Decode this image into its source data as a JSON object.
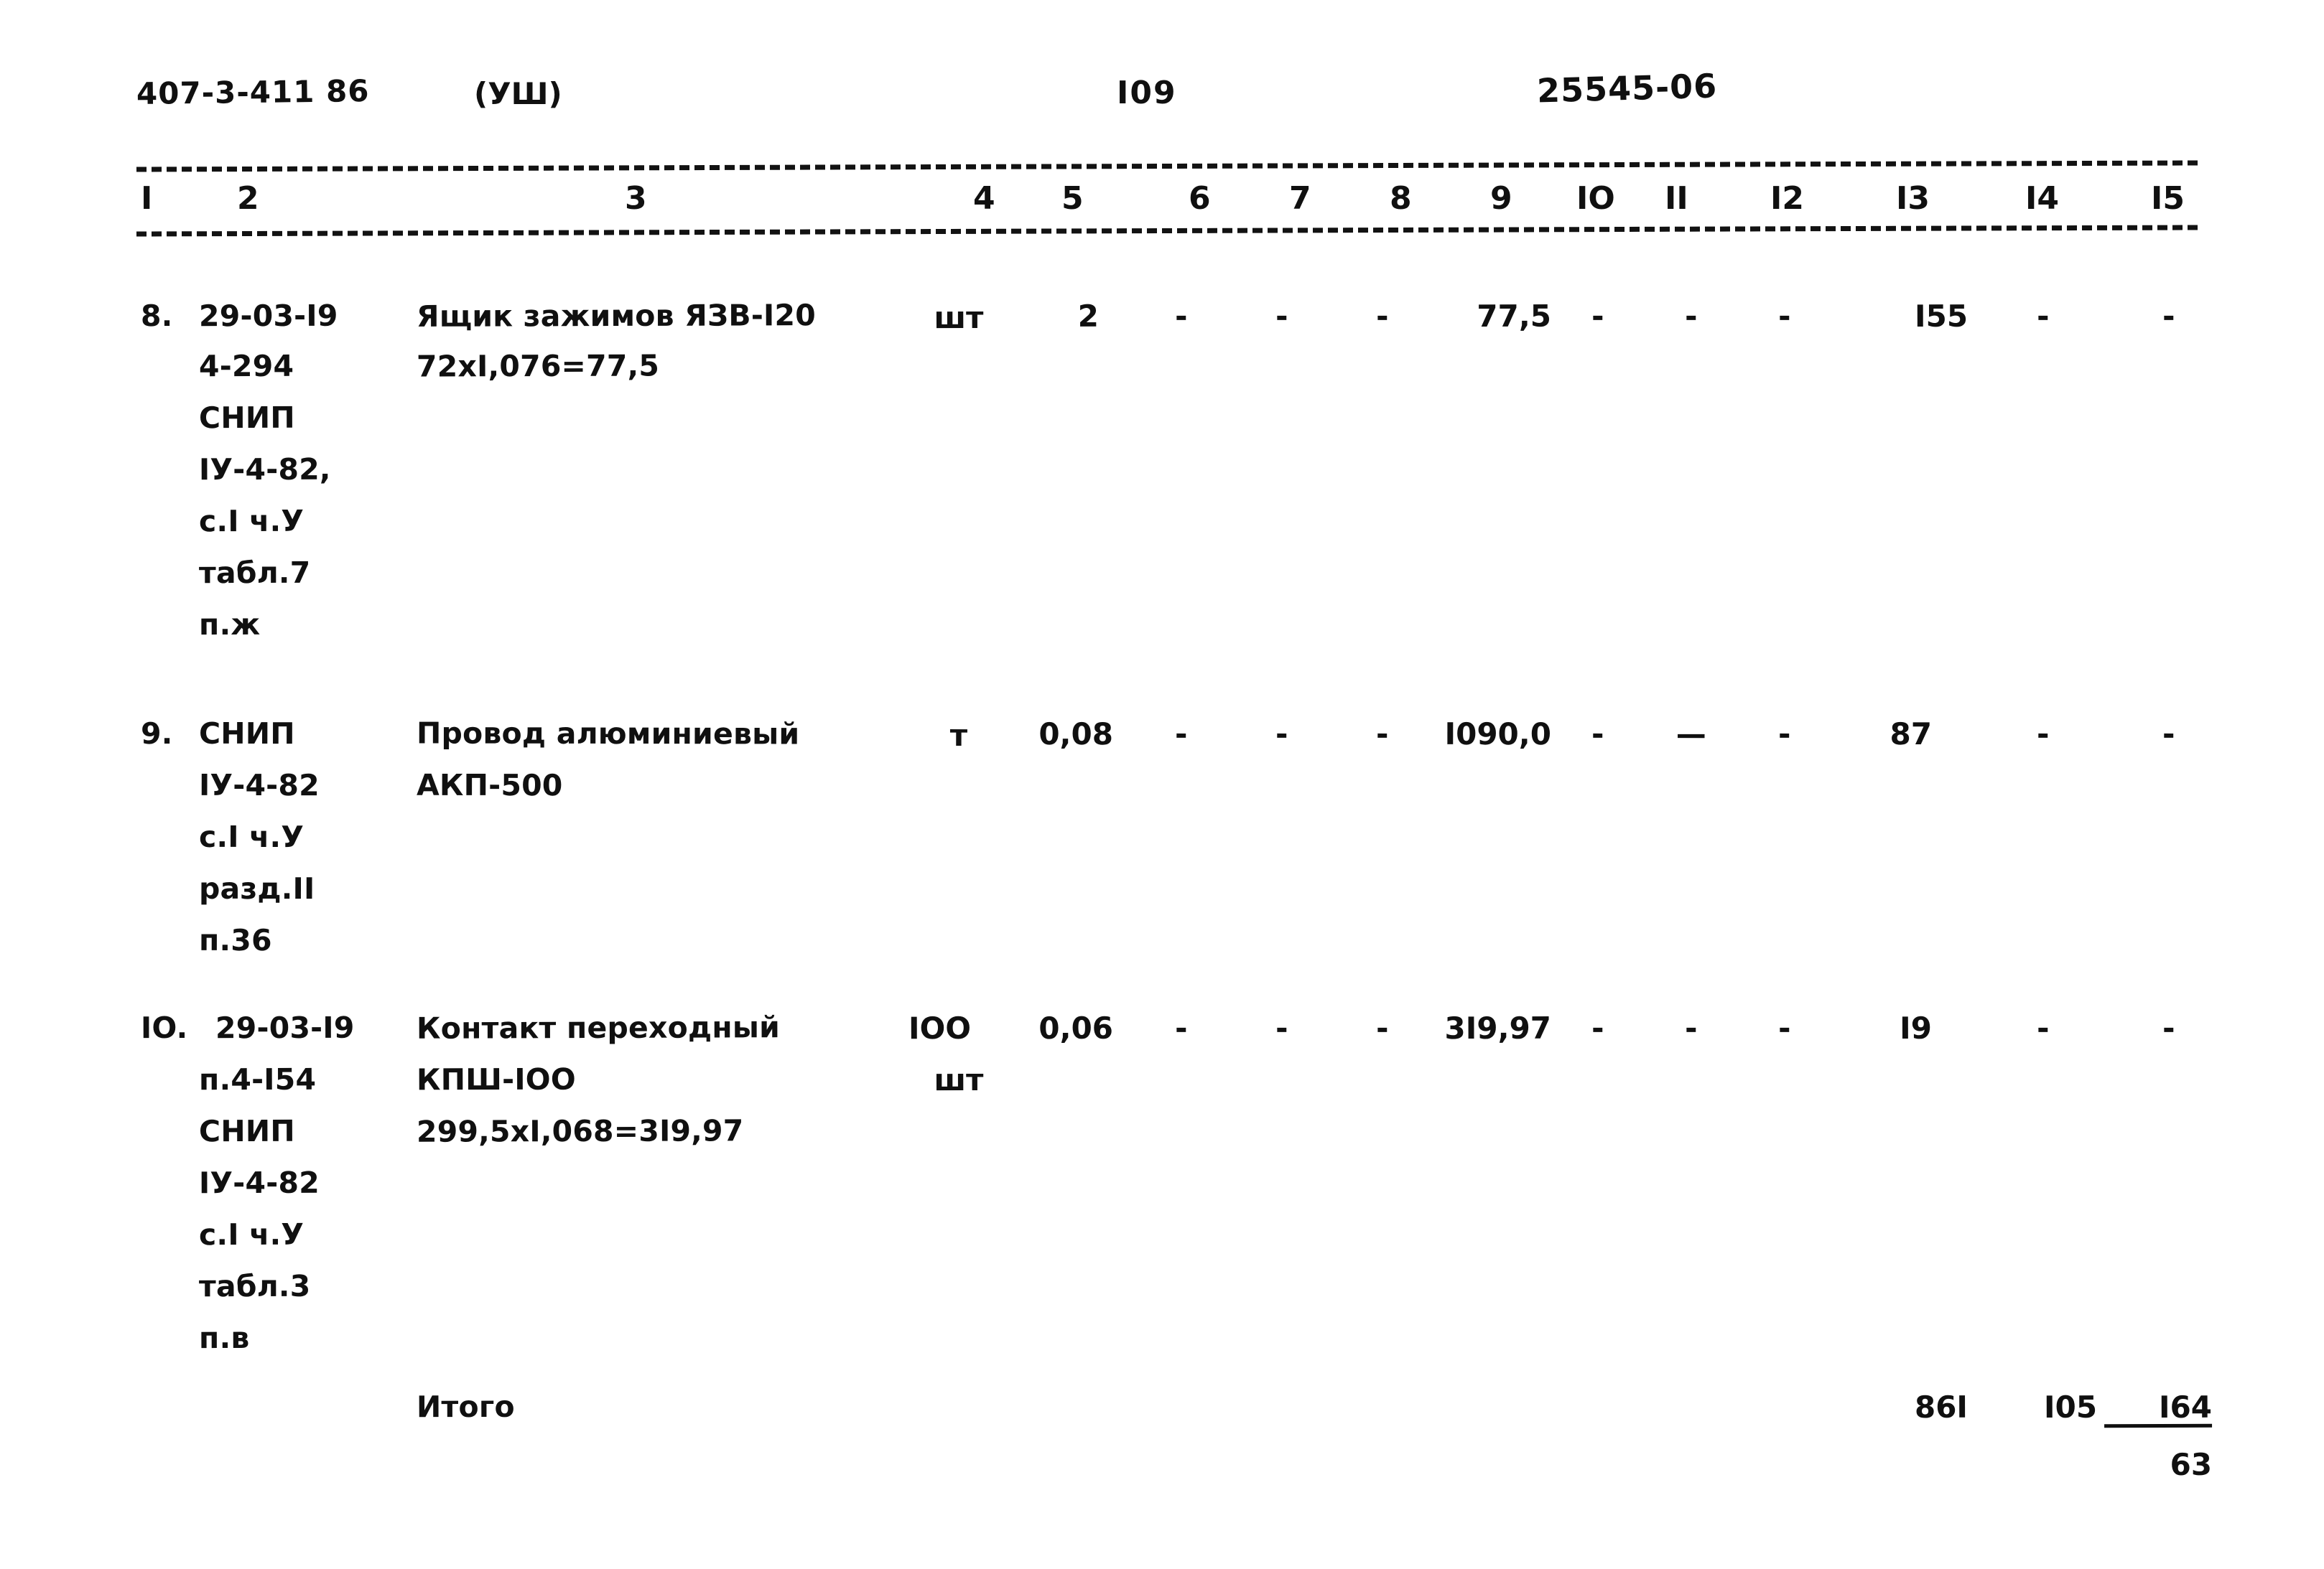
{
  "header": {
    "series_code": "407-3-411 86",
    "part_label": "(УШ)",
    "page_number": "I09",
    "doc_number": "25545-06"
  },
  "table": {
    "column_numbers": [
      "I",
      "2",
      "3",
      "4",
      "5",
      "6",
      "7",
      "8",
      "9",
      "IO",
      "II",
      "I2",
      "I3",
      "I4",
      "I5"
    ],
    "rows": [
      {
        "index": "8.",
        "code_lines": [
          "29-03-I9",
          "4-294",
          "СНИП",
          "IУ-4-82,",
          "с.I ч.У",
          "табл.7",
          "п.ж"
        ],
        "description_lines": [
          "Ящик зажимов ЯЗВ-I20",
          "72хI,076=77,5"
        ],
        "unit_lines": [
          "шт"
        ],
        "qty": "2",
        "c6": "-",
        "c7": "-",
        "c8": "-",
        "c9": "77,5",
        "c10": "-",
        "c11": "-",
        "c12": "-",
        "c13": "I55",
        "c14": "-",
        "c15": "-"
      },
      {
        "index": "9.",
        "code_lines": [
          "СНИП",
          "IУ-4-82",
          "с.I ч.У",
          "разд.II",
          "п.36"
        ],
        "description_lines": [
          "Провод алюминиевый",
          "АКП-500"
        ],
        "unit_lines": [
          "т"
        ],
        "qty": "0,08",
        "c6": "-",
        "c7": "-",
        "c8": "-",
        "c9": "I090,0",
        "c10": "-",
        "c11": "—",
        "c12": "-",
        "c13": "87",
        "c14": "-",
        "c15": "-"
      },
      {
        "index": "IO.",
        "code_lines": [
          "29-03-I9",
          "п.4-I54",
          "СНИП",
          "IУ-4-82",
          "с.I ч.У",
          "табл.3",
          "п.в"
        ],
        "description_lines": [
          "Контакт переходный",
          "КПШ-IOO",
          "299,5хI,068=3I9,97"
        ],
        "unit_lines": [
          "IOO",
          "шт"
        ],
        "qty": "0,06",
        "c6": "-",
        "c7": "-",
        "c8": "-",
        "c9": "3I9,97",
        "c10": "-",
        "c11": "-",
        "c12": "-",
        "c13": "I9",
        "c14": "-",
        "c15": "-"
      }
    ],
    "total": {
      "label": "Итого",
      "c13": "86I",
      "c14": "I05",
      "c15": "I64",
      "c15_second": "63"
    }
  }
}
